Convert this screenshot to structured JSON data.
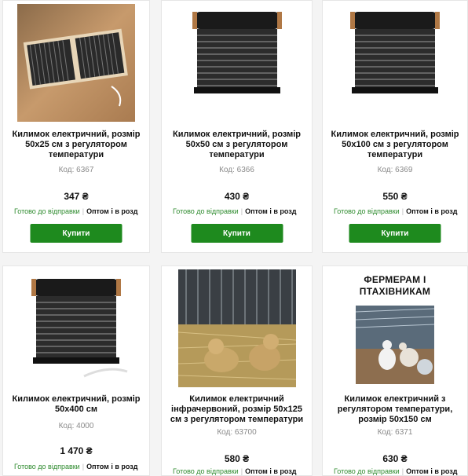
{
  "products": [
    {
      "title": "Килимок електричний, розмір 50х25 см з регулятором температури",
      "code": "Код: 6367",
      "price": "347 ₴",
      "ready": "Готово до відправки",
      "opt": "Оптом і в розд",
      "buy": "Купити"
    },
    {
      "title": "Килимок електричний, розмір 50х50 см з регулятором температури",
      "code": "Код: 6366",
      "price": "430 ₴",
      "ready": "Готово до відправки",
      "opt": "Оптом і в розд",
      "buy": "Купити"
    },
    {
      "title": "Килимок електричний, розмір 50х100 см з регулятором температури",
      "code": "Код: 6369",
      "price": "550 ₴",
      "ready": "Готово до відправки",
      "opt": "Оптом і в розд",
      "buy": "Купити"
    },
    {
      "title": "Килимок електричний, розмір 50х400 см",
      "code": "Код: 4000",
      "price": "1 470 ₴",
      "ready": "Готово до відправки",
      "opt": "Оптом і в розд"
    },
    {
      "title": "Килимок електричний інфрачервоний, розмір 50х125 см з регулятором температури",
      "code": "Код: 63700",
      "price": "580 ₴",
      "ready": "Готово до відправки",
      "opt": "Оптом і в розд"
    },
    {
      "title": "Килимок електричний з регулятором температури, розмір 50х150 см",
      "code": "Код: 6371",
      "price": "630 ₴",
      "ready": "Готово до відправки",
      "opt": "Оптом і в розд",
      "image_caption": "ФЕРМЕРАМ І ПТАХІВНИКАМ"
    }
  ],
  "colors": {
    "buy_button": "#1e8a1e",
    "ready_text": "#2e8b2e",
    "page_bg": "#f4f4f4"
  }
}
